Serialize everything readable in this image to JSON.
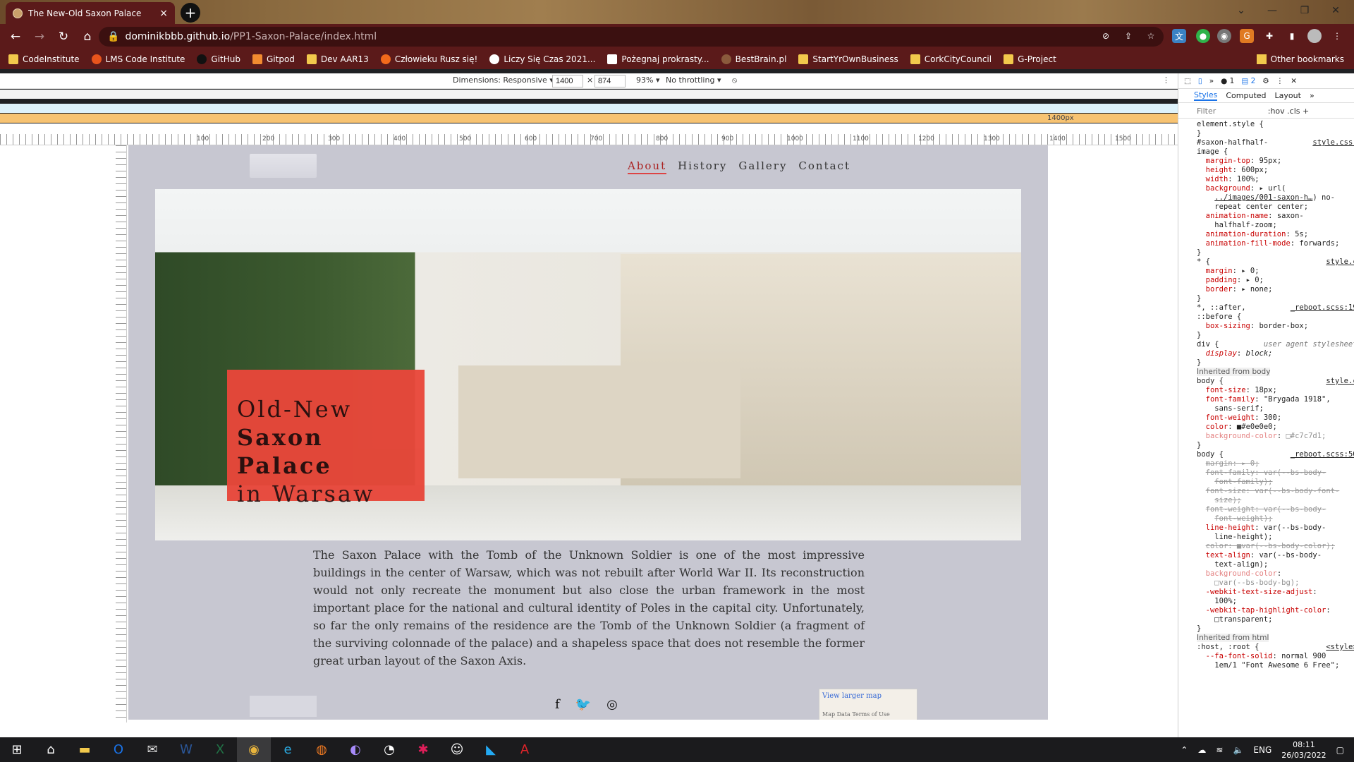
{
  "browser": {
    "tab_title": "The New-Old Saxon Palace",
    "tab_close": "×",
    "new_tab": "+",
    "window_controls": [
      "⌄",
      "—",
      "❐",
      "✕"
    ],
    "url_host": "dominikbbb.github.io",
    "url_path": "/PP1-Saxon-Palace/index.html",
    "bookmarks": [
      "CodeInstitute",
      "LMS Code Institute",
      "GitHub",
      "Gitpod",
      "Dev AAR13",
      "Człowieku Rusz się!",
      "Liczy Się Czas 2021...",
      "Pożegnaj prokrasty...",
      "BestBrain.pl",
      "StartYrOwnBusiness",
      "CorkCityCouncil",
      "G-Project"
    ],
    "other_bookmarks": "Other bookmarks"
  },
  "device_toolbar": {
    "dimensions_label": "Dimensions: Responsive ▾",
    "width": "1400",
    "times": "×",
    "height": "874",
    "zoom": "93% ▾",
    "throttle": "No throttling ▾",
    "breakpoint_label": "1400px"
  },
  "ruler_ticks": [
    "100",
    "200",
    "300",
    "400",
    "500",
    "600",
    "700",
    "800",
    "900",
    "1000",
    "1100",
    "1200",
    "1300",
    "1400",
    "1500"
  ],
  "site": {
    "nav": [
      "About",
      "History",
      "Gallery",
      "Contact"
    ],
    "hero_line1": "Old-New",
    "hero_line2": "Saxon Palace",
    "hero_line3": "in Warsaw",
    "intro": "The Saxon Palace with the Tomb of the Unknown Soldier is one of the most impressive buildings in the center of Warsaw, which was not rebuilt after World War II. Its reconstruction would not only recreate the monument but also close the urban framework in the most important place for the national and cultural identity of Poles in the capital city. Unfortunately, so far the only remains of the residence are the Tomb of the Unknown Soldier (a fragment of the surviving colonnade of the palace) and a shapeless space that does not resemble the former great urban layout of the Saxon Axis.",
    "map_link": "View larger map",
    "map_footer": "Map Data   Terms of Use"
  },
  "devtools": {
    "tabs": [
      "Styles",
      "Computed",
      "Layout",
      "»"
    ],
    "badges": [
      "1",
      "2"
    ],
    "filter_placeholder": "Filter",
    "filter_tools": ":hov  .cls  +",
    "inherited_body": "Inherited from body",
    "inherited_html": "Inherited from html"
  },
  "taskbar": {
    "lang": "ENG",
    "time": "08:11",
    "date": "26/03/2022"
  }
}
